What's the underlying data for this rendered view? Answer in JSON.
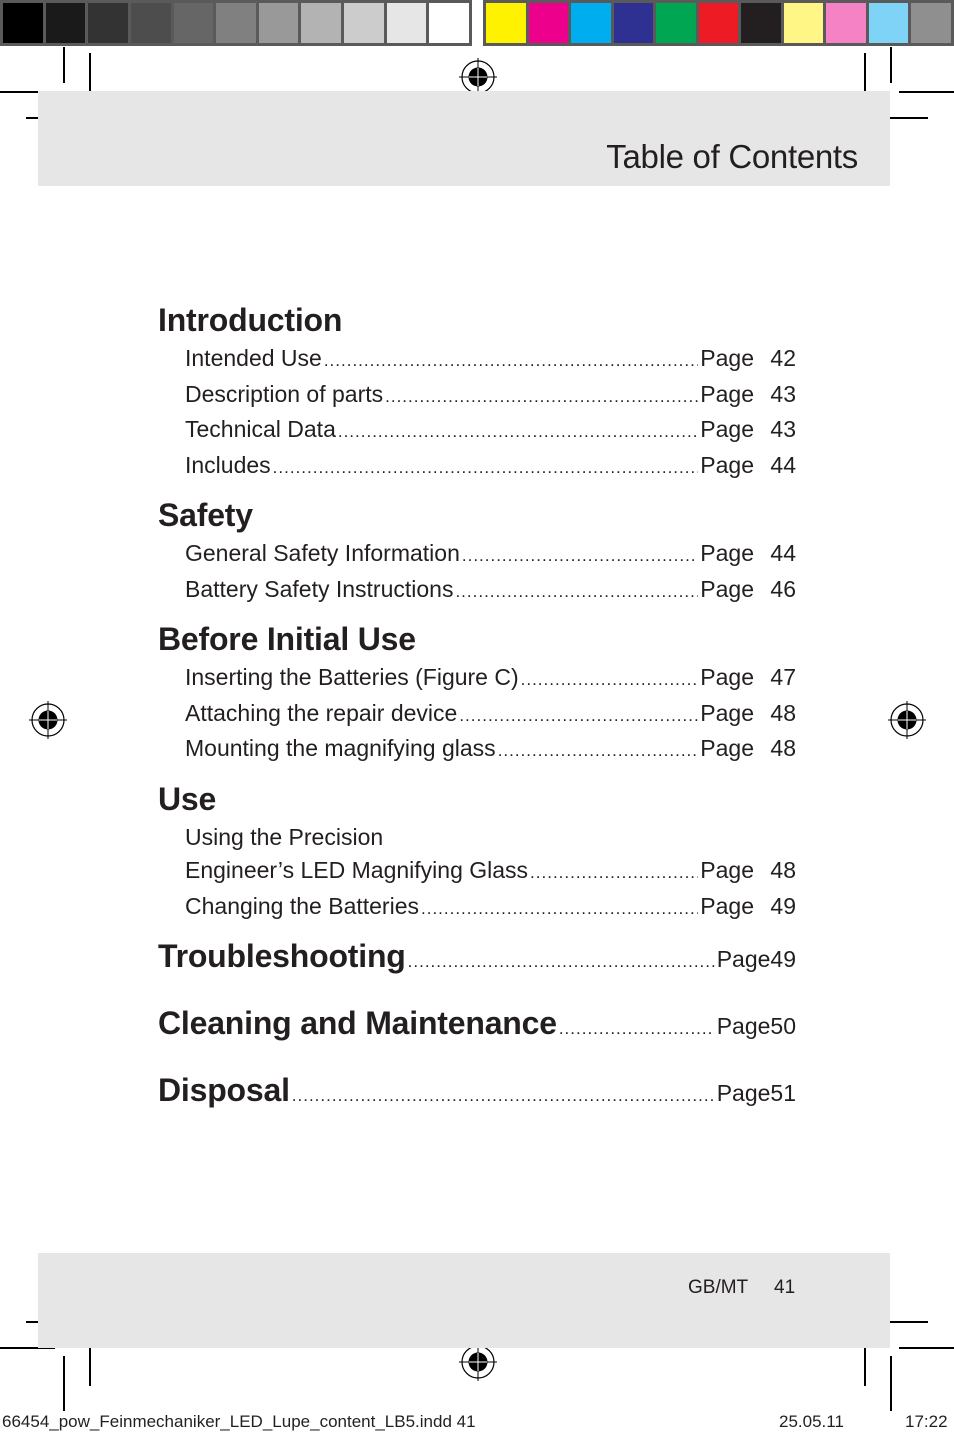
{
  "color_bar": {
    "grayscale": [
      "#000000",
      "#1a1a1a",
      "#333333",
      "#4d4d4d",
      "#666666",
      "#808080",
      "#999999",
      "#b3b3b3",
      "#cccccc",
      "#e6e6e6",
      "#ffffff"
    ],
    "process": [
      "#fff200",
      "#ec008c",
      "#00aeef",
      "#2e3192",
      "#00a651",
      "#ed1c24",
      "#231f20",
      "#fff685",
      "#f682c6",
      "#7fd3f7",
      "#8f8f8f"
    ]
  },
  "header": {
    "title": "Table of Contents"
  },
  "toc": {
    "sections": [
      {
        "title": "Introduction",
        "entries": [
          {
            "label": "Intended Use",
            "page_word": "Page",
            "page": "42"
          },
          {
            "label": "Description of parts",
            "page_word": "Page",
            "page": "43"
          },
          {
            "label": "Technical Data",
            "page_word": "Page",
            "page": "43"
          },
          {
            "label": "Includes",
            "page_word": "Page",
            "page": "44"
          }
        ]
      },
      {
        "title": "Safety",
        "entries": [
          {
            "label": "General Safety Information",
            "page_word": "Page",
            "page": "44"
          },
          {
            "label": "Battery Safety Instructions",
            "page_word": "Page",
            "page": "46"
          }
        ]
      },
      {
        "title": "Before Initial Use",
        "entries": [
          {
            "label": "Inserting the Batteries (Figure C)",
            "page_word": "Page",
            "page": "47"
          },
          {
            "label": "Attaching the repair device",
            "page_word": "Page",
            "page": "48"
          },
          {
            "label": "Mounting the magnifying glass",
            "page_word": "Page",
            "page": "48"
          }
        ]
      },
      {
        "title": "Use",
        "entries": [
          {
            "label": "Using the Precision",
            "page_word": "",
            "page": ""
          },
          {
            "label": "Engineer’s LED Magnifying Glass",
            "page_word": "Page",
            "page": "48"
          },
          {
            "label": "Changing the Batteries",
            "page_word": "Page",
            "page": "49"
          }
        ]
      }
    ],
    "top_level": [
      {
        "title": "Troubleshooting",
        "page_word": "Page",
        "page": "49"
      },
      {
        "title": "Cleaning and Maintenance",
        "page_word": "Page",
        "page": "50"
      },
      {
        "title": "Disposal",
        "page_word": "Page",
        "page": "51"
      }
    ]
  },
  "footer": {
    "language": "GB/MT",
    "page_number": "41"
  },
  "slug": {
    "filename": "66454_pow_Feinmechaniker_LED_Lupe_content_LB5.indd   41",
    "date": "25.05.11",
    "time": "17:22"
  }
}
